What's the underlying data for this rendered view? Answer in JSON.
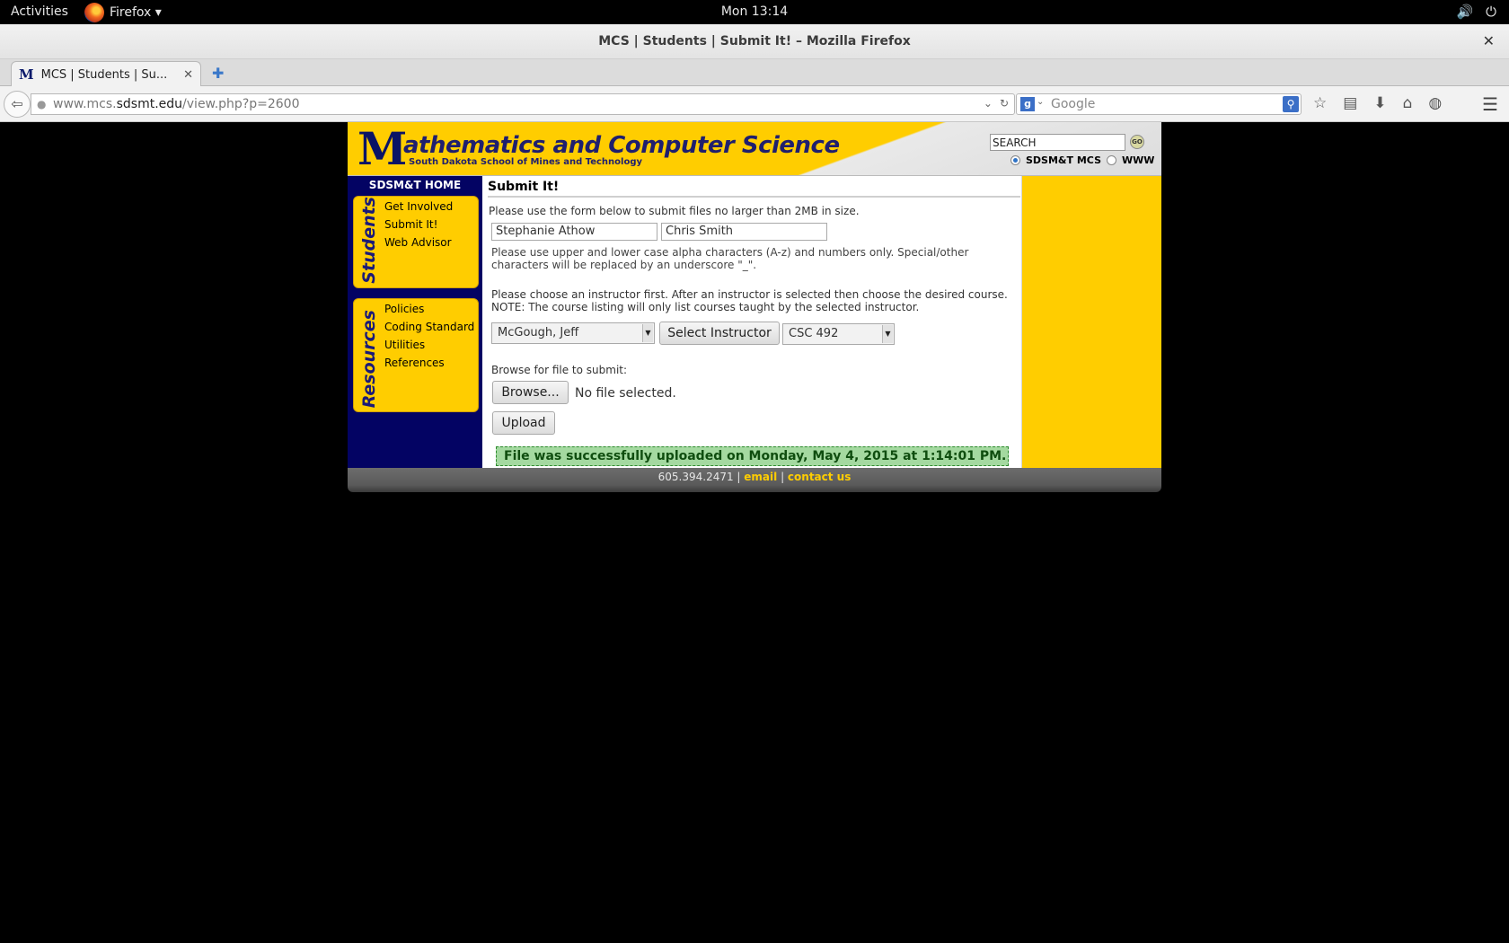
{
  "desktop": {
    "activities": "Activities",
    "app_name": "Firefox ▾",
    "clock": "Mon 13:14",
    "volume_icon": "🔊",
    "power_icon": "⏻"
  },
  "window": {
    "title": "MCS | Students | Submit It! – Mozilla Firefox",
    "close": "✕"
  },
  "tabs": [
    {
      "favicon": "M",
      "label": "MCS | Students | Su...",
      "close": "✕"
    }
  ],
  "new_tab": "✚",
  "navbar": {
    "back": "⇦",
    "url_prefix": "www.mcs.",
    "url_host": "sdsmt.edu",
    "url_path": "/view.php?p=2600",
    "search_placeholder": "Google",
    "search_engine": "g"
  },
  "site": {
    "banner": {
      "big_m": "M",
      "title": "athematics and Computer Science",
      "subtitle": "South Dakota School of Mines and Technology",
      "search_value": "SEARCH",
      "go_label": "GO",
      "radio_mcs": "SDSM&T MCS",
      "radio_www": "WWW"
    },
    "leftnav": {
      "home": "SDSM&T HOME",
      "students_label": "Students",
      "students_links": [
        "Get Involved",
        "Submit It!",
        "Web Advisor"
      ],
      "resources_label": "Resources",
      "resources_links": [
        "Policies",
        "Coding Standard",
        "Utilities",
        "References"
      ]
    },
    "content": {
      "heading": "Submit It!",
      "intro": "Please use the form below to submit files no larger than 2MB in size.",
      "name1": "Stephanie Athow",
      "name2": "Chris Smith",
      "chars_note": "Please use upper and lower case alpha characters (A-z) and numbers only. Special/other characters will be replaced by an underscore \"_\".",
      "instructor_note_1": "Please choose an instructor first. After an instructor is selected then choose the desired course.",
      "instructor_note_2": "NOTE: The course listing will only list courses taught by the selected instructor.",
      "instructor_selected": "McGough, Jeff",
      "select_instructor_button": "Select Instructor",
      "course_selected": "CSC 492",
      "browse_label": "Browse for file to submit:",
      "browse_button": "Browse...",
      "no_file": "No file selected.",
      "upload_button": "Upload",
      "success_message": "File was successfully uploaded on Monday, May 4, 2015 at 1:14:01 PM."
    },
    "footer": {
      "phone": "605.394.2471 | ",
      "email": "email",
      "sep": " | ",
      "contact": "contact us"
    }
  }
}
